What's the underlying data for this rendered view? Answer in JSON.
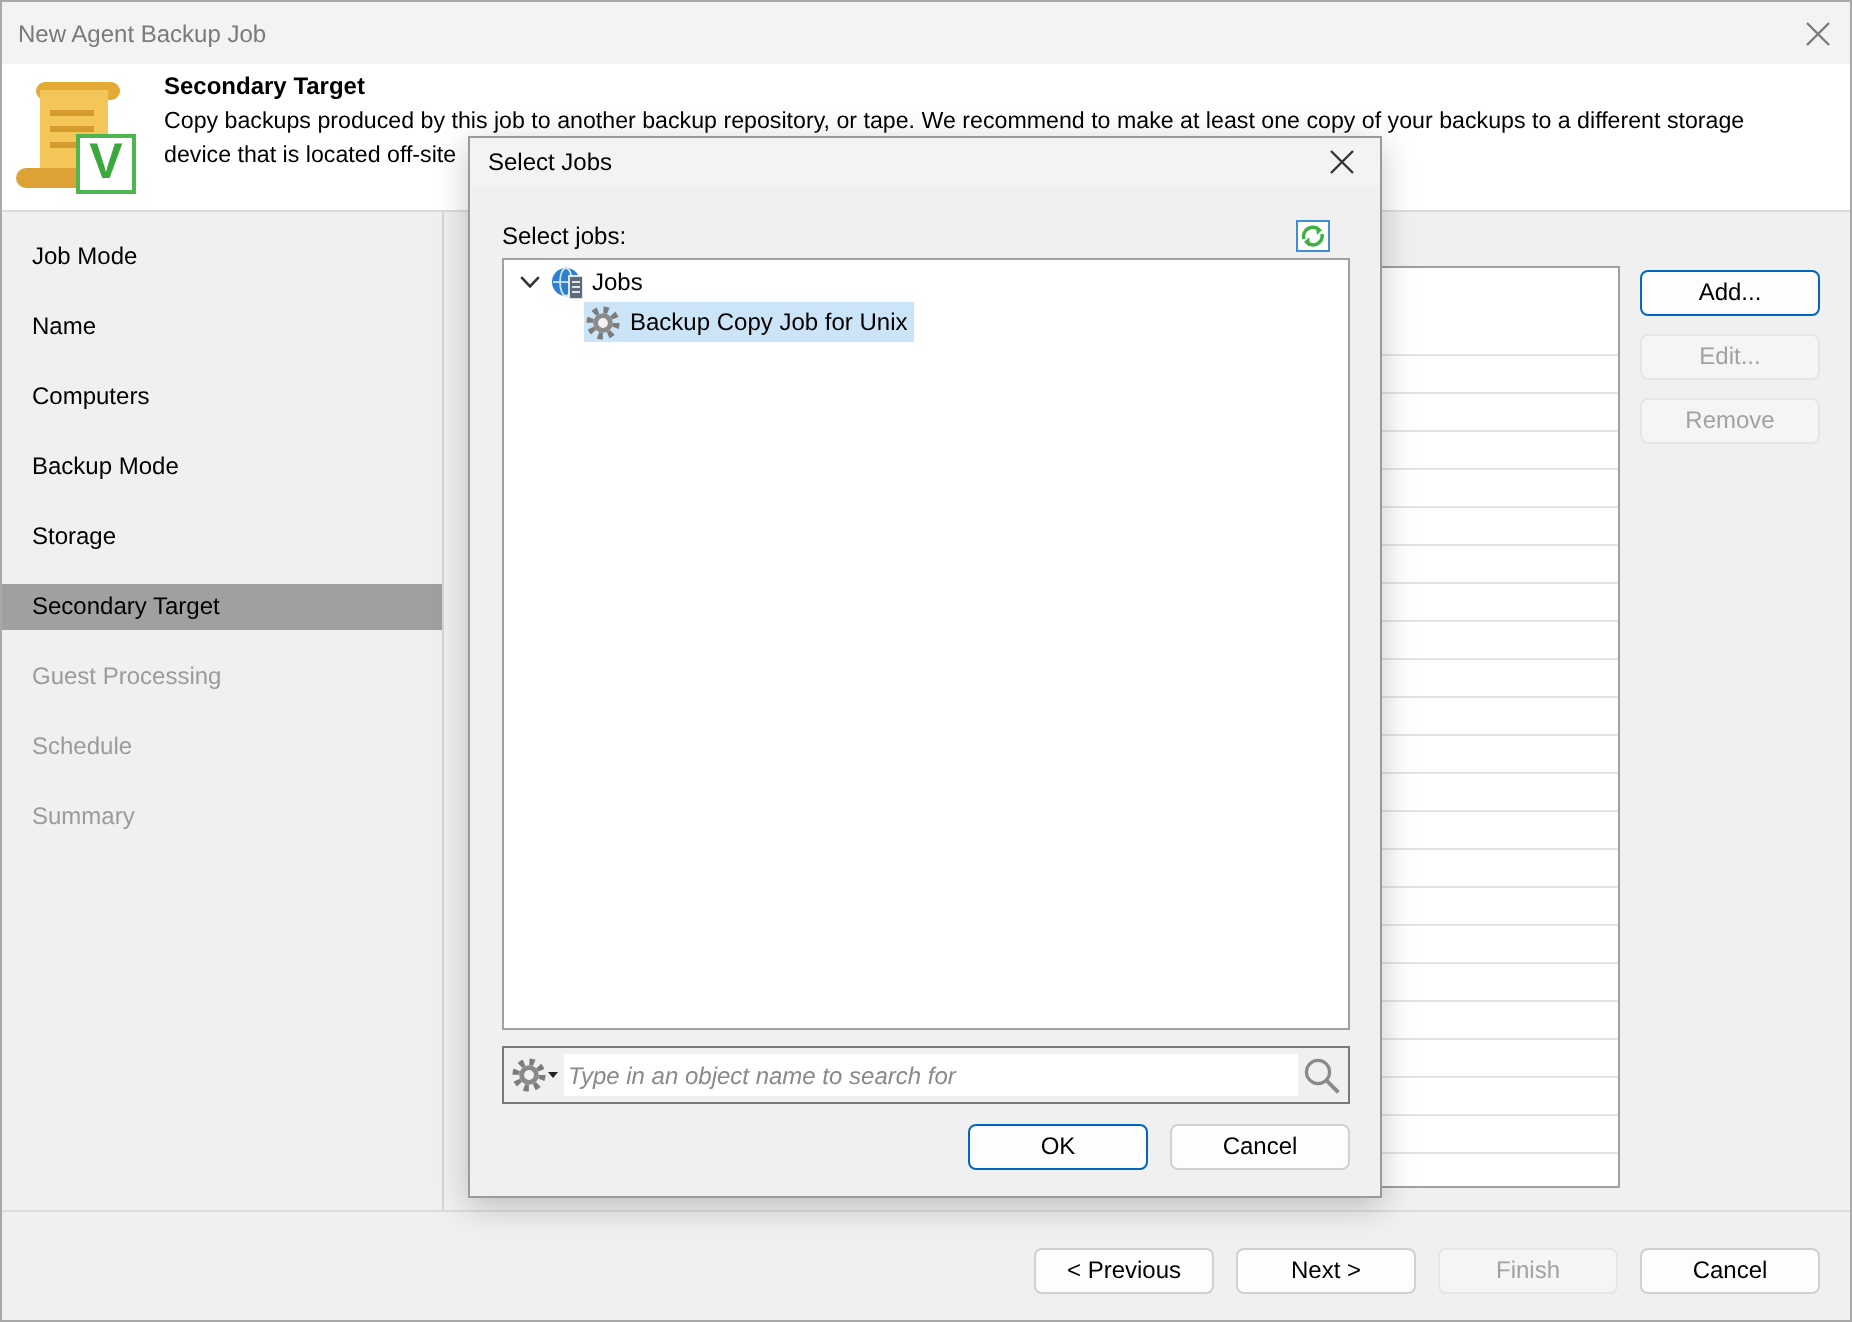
{
  "window": {
    "title": "New Agent Backup Job"
  },
  "header": {
    "title": "Secondary Target",
    "description_lines": [
      "Copy backups produced by this job to another backup repository, or tape. We recommend to make at least one copy of your backups to a different storage",
      "device that is located off-site"
    ],
    "badge": "V"
  },
  "steps": [
    {
      "label": "Job Mode",
      "selected": false,
      "disabled": false
    },
    {
      "label": "Name",
      "selected": false,
      "disabled": false
    },
    {
      "label": "Computers",
      "selected": false,
      "disabled": false
    },
    {
      "label": "Backup Mode",
      "selected": false,
      "disabled": false
    },
    {
      "label": "Storage",
      "selected": false,
      "disabled": false
    },
    {
      "label": "Secondary Target",
      "selected": true,
      "disabled": false
    },
    {
      "label": "Guest Processing",
      "selected": false,
      "disabled": true
    },
    {
      "label": "Schedule",
      "selected": false,
      "disabled": true
    },
    {
      "label": "Summary",
      "selected": false,
      "disabled": true
    }
  ],
  "side_buttons": [
    {
      "label": "Add...",
      "disabled": false,
      "focused": true
    },
    {
      "label": "Edit...",
      "disabled": true,
      "focused": false
    },
    {
      "label": "Remove",
      "disabled": true,
      "focused": false
    }
  ],
  "footer_buttons": [
    {
      "label": "< Previous",
      "disabled": false
    },
    {
      "label": "Next >",
      "disabled": false
    },
    {
      "label": "Finish",
      "disabled": true
    },
    {
      "label": "Cancel",
      "disabled": false
    }
  ],
  "dialog": {
    "title": "Select Jobs",
    "label": "Select jobs:",
    "tree": [
      {
        "kind": "folder",
        "label": "Jobs",
        "expanded": true,
        "selected": false,
        "children": [
          {
            "kind": "job",
            "label": "Backup Copy Job for Unix",
            "selected": true
          }
        ]
      }
    ],
    "search": {
      "placeholder": "Type in an object name to search for"
    },
    "buttons": [
      {
        "label": "OK",
        "default": true
      },
      {
        "label": "Cancel",
        "default": false
      }
    ]
  }
}
